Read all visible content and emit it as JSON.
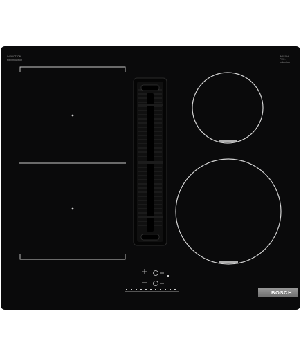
{
  "product": {
    "brand": "BOSCH",
    "top_left_marking": [
      "INDUCTION",
      "FlexInduction"
    ],
    "top_right_marking": [
      "BOSCH",
      "PXV...",
      "Induction"
    ]
  },
  "colors": {
    "glass": "#0a0a0b",
    "marking_lines": "#c9c9c9",
    "badge": "#8a8a8a"
  },
  "icons": [
    "induction-zone",
    "flex-zone",
    "downdraft-vent",
    "touch-control"
  ]
}
